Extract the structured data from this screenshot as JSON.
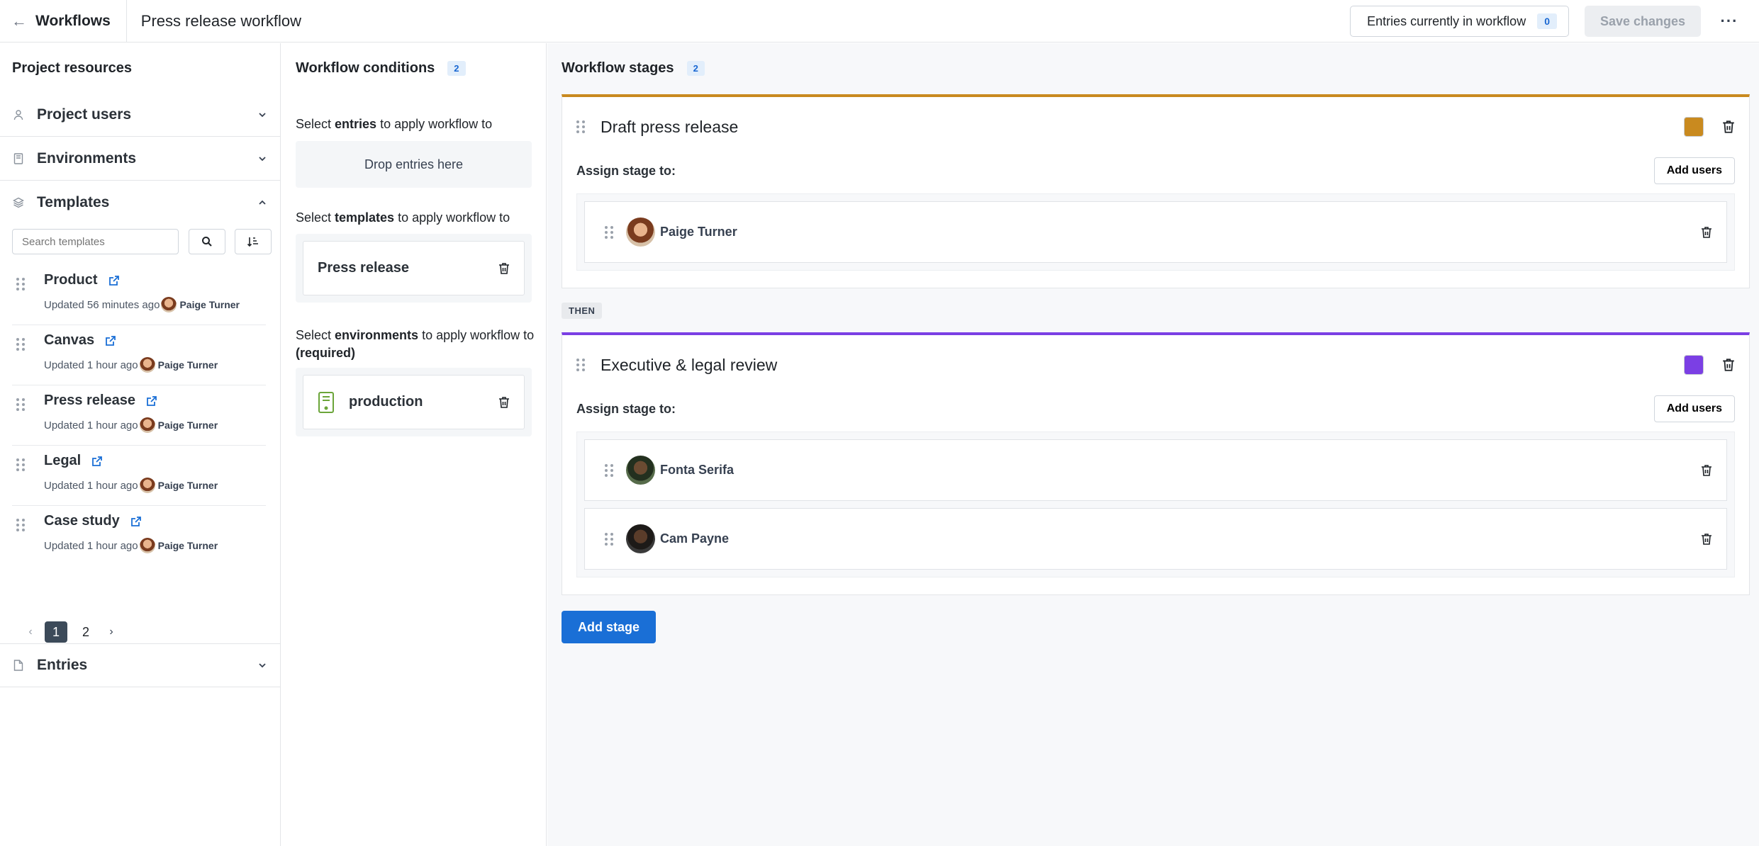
{
  "header": {
    "back_label": "Workflows",
    "title": "Press release workflow",
    "entries_label": "Entries currently in workflow",
    "entries_count": "0",
    "save_label": "Save changes",
    "more_label": "···"
  },
  "left": {
    "title": "Project resources",
    "sections": {
      "users": "Project users",
      "environments": "Environments",
      "templates": "Templates",
      "entries": "Entries"
    },
    "search_placeholder": "Search templates",
    "templates": [
      {
        "name": "Product",
        "updated": "Updated 56 minutes ago",
        "user": "Paige Turner"
      },
      {
        "name": "Canvas",
        "updated": "Updated 1 hour ago",
        "user": "Paige Turner"
      },
      {
        "name": "Press release",
        "updated": "Updated 1 hour ago",
        "user": "Paige Turner"
      },
      {
        "name": "Legal",
        "updated": "Updated 1 hour ago",
        "user": "Paige Turner"
      },
      {
        "name": "Case study",
        "updated": "Updated 1 hour ago",
        "user": "Paige Turner"
      }
    ],
    "pagination": {
      "page1": "1",
      "page2": "2",
      "prev": "‹",
      "next": "›"
    }
  },
  "conditions": {
    "title": "Workflow conditions",
    "count": "2",
    "entries_prefix": "Select ",
    "entries_bold": "entries",
    "entries_suffix": " to apply workflow to",
    "drop_label": "Drop entries here",
    "templates_prefix": "Select ",
    "templates_bold": "templates",
    "templates_suffix": " to apply workflow to",
    "template_selected": "Press release",
    "env_prefix": "Select ",
    "env_bold": "environments",
    "env_suffix": " to apply workflow to ",
    "env_required": "(required)",
    "env_selected": "production"
  },
  "stages": {
    "title": "Workflow stages",
    "count": "2",
    "assign_label": "Assign stage to:",
    "add_users_label": "Add users",
    "then_label": "THEN",
    "add_stage_label": "Add stage",
    "list": [
      {
        "name": "Draft press release",
        "color": "#c98a1f",
        "users": [
          "Paige Turner"
        ]
      },
      {
        "name": "Executive & legal review",
        "color": "#7b3fe4",
        "users": [
          "Fonta Serifa",
          "Cam Payne"
        ]
      }
    ]
  },
  "colors": {
    "accent": "#1a6fd6",
    "stage1": "#c98a1f",
    "stage2": "#7b3fe4",
    "environment_icon": "#6ba539"
  },
  "icons": {
    "back": "arrow-left-icon",
    "users": "user-icon",
    "environments": "document-icon",
    "templates": "layers-icon",
    "entries": "file-icon",
    "search": "search-icon",
    "sort": "sort-icon",
    "external": "external-link-icon",
    "trash": "trash-icon",
    "drag": "drag-handle-icon"
  }
}
